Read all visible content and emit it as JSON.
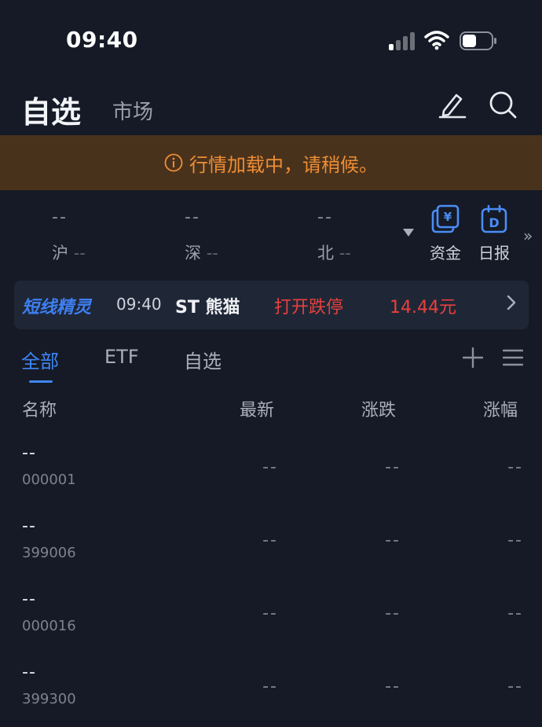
{
  "status_bar": {
    "time": "09:40"
  },
  "header": {
    "tab_watchlist": "自选",
    "tab_market": "市场"
  },
  "banner": {
    "text": "行情加载中，请稍候。",
    "color": "#ee8e35"
  },
  "indices": [
    {
      "value": "--",
      "label": "沪",
      "change": "--"
    },
    {
      "value": "--",
      "label": "深",
      "change": "--"
    },
    {
      "value": "--",
      "label": "北",
      "change": "--"
    }
  ],
  "quick_actions": [
    {
      "label": "资金",
      "icon": "funds-icon"
    },
    {
      "label": "日报",
      "icon": "daily-report-icon"
    }
  ],
  "more_glyph": "»",
  "alert": {
    "brand": "短线精灵",
    "time": "09:40",
    "stock": "ST 熊猫",
    "event": "打开跌停",
    "price": "14.44元",
    "accent": "#e8403c"
  },
  "list_tabs": [
    {
      "label": "全部",
      "active": true
    },
    {
      "label": "ETF",
      "active": false
    },
    {
      "label": "自选",
      "active": false
    }
  ],
  "columns": {
    "name": "名称",
    "latest": "最新",
    "change": "涨跌",
    "change_pct": "涨幅"
  },
  "rows": [
    {
      "name": "--",
      "code": "000001",
      "latest": "--",
      "change": "--",
      "change_pct": "--"
    },
    {
      "name": "--",
      "code": "399006",
      "latest": "--",
      "change": "--",
      "change_pct": "--"
    },
    {
      "name": "--",
      "code": "000016",
      "latest": "--",
      "change": "--",
      "change_pct": "--"
    },
    {
      "name": "--",
      "code": "399300",
      "latest": "--",
      "change": "--",
      "change_pct": "--"
    }
  ],
  "colors": {
    "background": "#151a26",
    "accent_blue": "#3f86f5",
    "banner_bg": "#49321c"
  }
}
